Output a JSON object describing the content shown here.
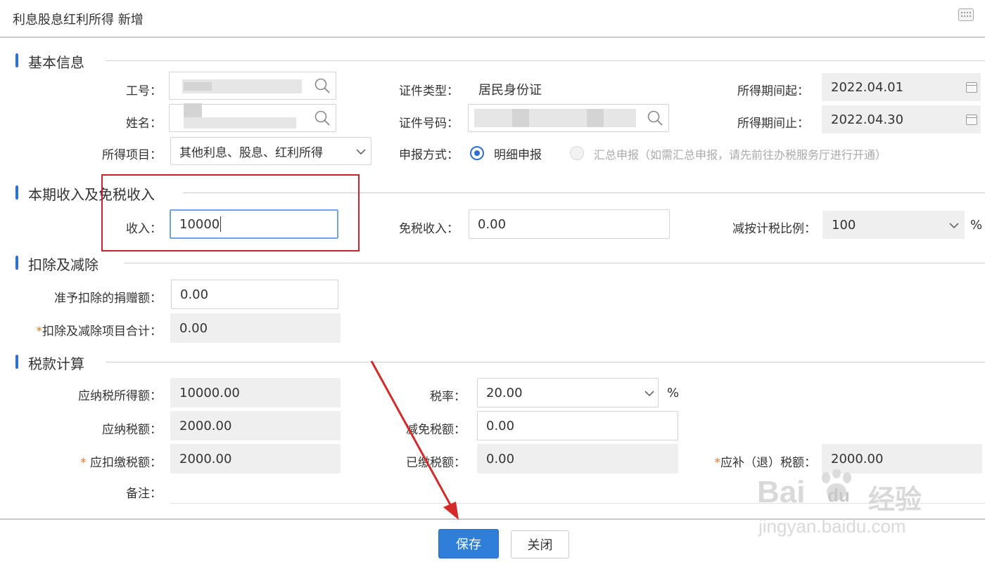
{
  "window": {
    "title": "利息股息红利所得 新增"
  },
  "sections": {
    "basic": "基本信息",
    "income": "本期收入及免税收入",
    "deduction": "扣除及减除",
    "tax": "税款计算"
  },
  "basic": {
    "emp_id_label": "工号：",
    "name_label": "姓名：",
    "item_label": "所得项目：",
    "item_value": "其他利息、股息、红利所得",
    "id_type_label": "证件类型：",
    "id_type_value": "居民身份证",
    "id_no_label": "证件号码：",
    "report_label": "申报方式：",
    "report_detail": "明细申报",
    "report_summary": "汇总申报（如需汇总申报，请先前往办税服务厅进行开通）",
    "period_start_label": "所得期间起：",
    "period_start_value": "2022.04.01",
    "period_end_label": "所得期间止：",
    "period_end_value": "2022.04.30"
  },
  "income": {
    "income_label": "收入：",
    "income_value": "10000",
    "exempt_label": "免税收入：",
    "exempt_value": "0.00",
    "ratio_label": "减按计税比例：",
    "ratio_value": "100",
    "ratio_unit": "%"
  },
  "deduction": {
    "donation_label": "准予扣除的捐赠额：",
    "donation_value": "0.00",
    "total_req": "*",
    "total_label": "扣除及减除项目合计：",
    "total_value": "0.00"
  },
  "tax": {
    "taxable_income_label": "应纳税所得额：",
    "taxable_income_value": "10000.00",
    "tax_payable_label": "应纳税额：",
    "tax_payable_value": "2000.00",
    "withhold_req": "*",
    "withhold_label": "应扣缴税额：",
    "withhold_value": "2000.00",
    "remark_label": "备注：",
    "rate_label": "税率：",
    "rate_value": "20.00",
    "rate_unit": "%",
    "relief_label": "减免税额：",
    "relief_value": "0.00",
    "paid_label": "已缴税额：",
    "paid_value": "0.00",
    "refund_req": "*",
    "refund_label": "应补（退）税额：",
    "refund_value": "2000.00"
  },
  "footer": {
    "save": "保存",
    "close": "关闭"
  },
  "watermark": {
    "brand": "Bai",
    "brand_du": "du",
    "brand_cn": "经验",
    "url": "jingyan.baidu.com"
  },
  "colors": {
    "accent": "#2f6fd1",
    "primary_button": "#2f7fd8",
    "highlight_box": "#c9212e",
    "arrow": "#d42a2a"
  }
}
